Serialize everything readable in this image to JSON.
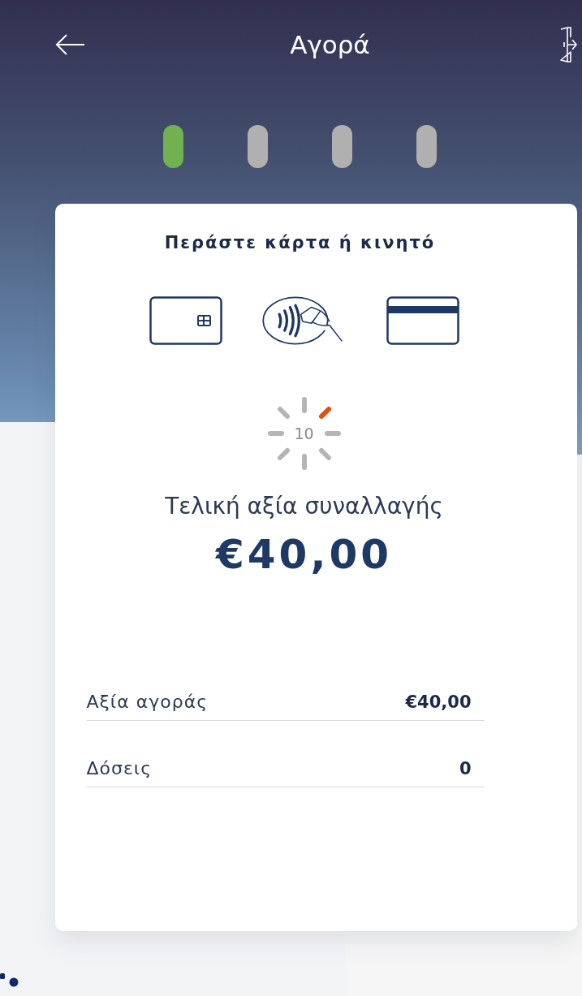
{
  "header": {
    "title": "Αγορά"
  },
  "steps": [
    {
      "selected": true
    },
    {
      "selected": false
    },
    {
      "selected": false
    },
    {
      "selected": false
    }
  ],
  "card": {
    "prompt": "Περάστε κάρτα ή κινητό",
    "countdown": "10",
    "total_label": "Τελική αξία συναλλαγής",
    "total_amount": "€40,00",
    "rows": [
      {
        "label": "Αξία αγοράς",
        "value": "€40,00"
      },
      {
        "label": "Δόσεις",
        "value": "0"
      }
    ]
  }
}
